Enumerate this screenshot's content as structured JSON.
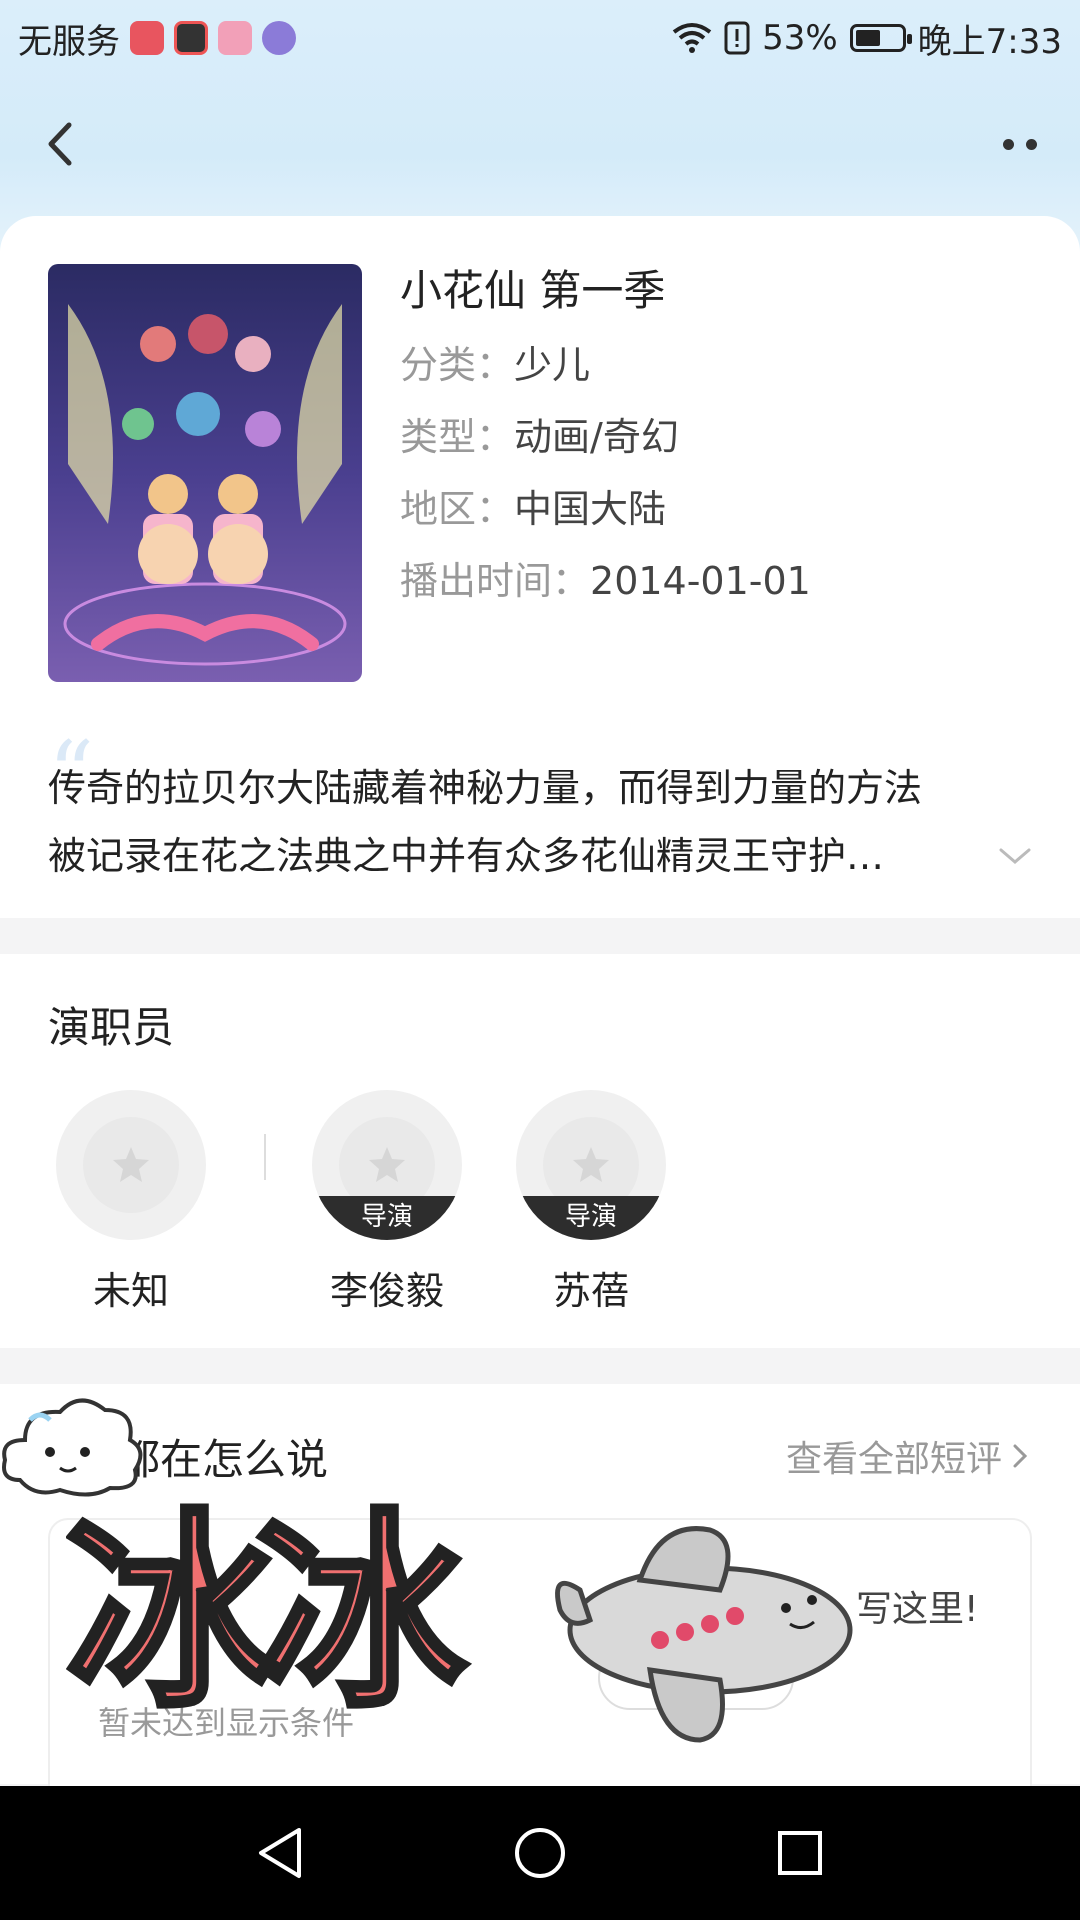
{
  "status": {
    "carrier": "无服务",
    "battery": "53%",
    "time": "晚上7:33"
  },
  "show": {
    "title": "小花仙 第一季",
    "category_label": "分类：",
    "category": "少儿",
    "genre_label": "类型：",
    "genre": "动画/奇幻",
    "region_label": "地区：",
    "region": "中国大陆",
    "air_label": "播出时间：",
    "air_date": "2014-01-01",
    "description_line1": "传奇的拉贝尔大陆藏着神秘力量，而得到力量的方法",
    "description_line2": "被记录在花之法典之中并有众多花仙精灵王守护…"
  },
  "cast": {
    "title": "演职员",
    "members": [
      {
        "name": "未知",
        "role": ""
      },
      {
        "name": "李俊毅",
        "role": "导演"
      },
      {
        "name": "苏蓓",
        "role": "导演"
      }
    ]
  },
  "reviews": {
    "title": "都在怎么说",
    "view_all": "查看全部短评",
    "score_note": "暂未达到显示条件",
    "write_hint_prefix": "",
    "write_hint": "写这里!"
  },
  "overlay": {
    "sticker_text": "冰冰"
  }
}
